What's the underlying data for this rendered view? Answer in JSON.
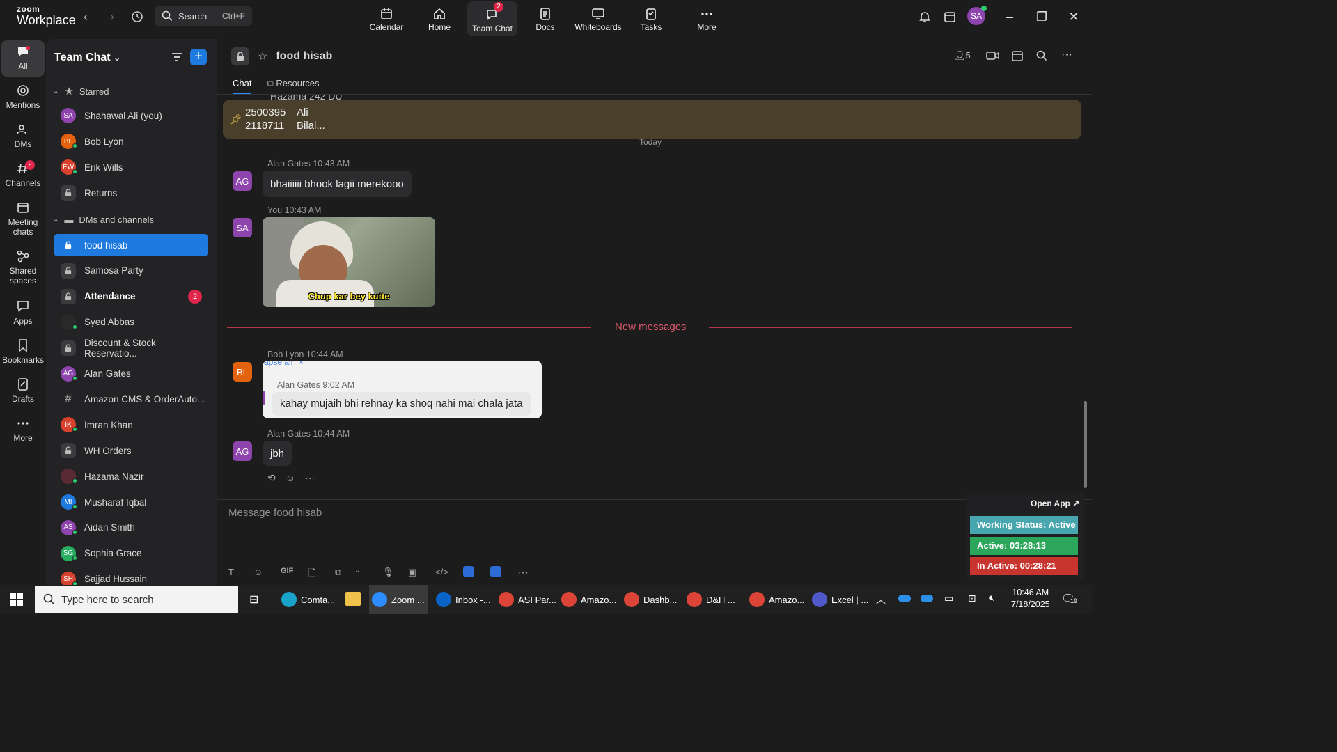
{
  "app": {
    "brand_line1": "zoom",
    "brand_line2": "Workplace"
  },
  "search": {
    "label": "Search",
    "shortcut": "Ctrl+F"
  },
  "top_tabs": [
    {
      "label": "Calendar"
    },
    {
      "label": "Home"
    },
    {
      "label": "Team Chat",
      "badge": "2"
    },
    {
      "label": "Docs"
    },
    {
      "label": "Whiteboards"
    },
    {
      "label": "Tasks"
    },
    {
      "label": "More"
    }
  ],
  "user_avatar": "SA",
  "rail": [
    {
      "label": "All"
    },
    {
      "label": "Mentions"
    },
    {
      "label": "DMs"
    },
    {
      "label": "Channels",
      "badge": "2"
    },
    {
      "label": "Meeting chats"
    },
    {
      "label": "Shared spaces"
    },
    {
      "label": "Apps"
    },
    {
      "label": "Bookmarks"
    },
    {
      "label": "Drafts"
    },
    {
      "label": "More"
    }
  ],
  "sidebar": {
    "title": "Team Chat",
    "starred_label": "Starred",
    "dms_label": "DMs and channels",
    "starred": [
      {
        "initials": "SA",
        "name": "Shahawal Ali (you)",
        "color": "#8e44ad"
      },
      {
        "initials": "BL",
        "name": "Bob Lyon",
        "color": "#e2620e"
      },
      {
        "initials": "EW",
        "name": "Erik Wills",
        "color": "#d9412f"
      },
      {
        "initials": "",
        "name": "Returns",
        "color": "#3b3b3d"
      }
    ],
    "items": [
      {
        "initials": "",
        "name": "food hisab",
        "color": ""
      },
      {
        "initials": "",
        "name": "Samosa Party",
        "color": ""
      },
      {
        "initials": "",
        "name": "Attendance",
        "color": "",
        "count": "2"
      },
      {
        "initials": "",
        "name": "Syed Abbas",
        "color": "#2a2a2a"
      },
      {
        "initials": "",
        "name": "Discount & Stock Reservatio...",
        "color": ""
      },
      {
        "initials": "AG",
        "name": "Alan Gates",
        "color": "#8e44ad"
      },
      {
        "initials": "#",
        "name": "Amazon CMS & OrderAuto...",
        "color": ""
      },
      {
        "initials": "IK",
        "name": "Imran Khan",
        "color": "#d9412f"
      },
      {
        "initials": "",
        "name": "WH Orders",
        "color": ""
      },
      {
        "initials": "",
        "name": "Hazama Nazir",
        "color": "#5a2a33"
      },
      {
        "initials": "MI",
        "name": "Musharaf Iqbal",
        "color": "#1f7ae0"
      },
      {
        "initials": "AS",
        "name": "Aidan Smith",
        "color": "#8e44ad"
      },
      {
        "initials": "SG",
        "name": "Sophia Grace",
        "color": "#27ae60"
      },
      {
        "initials": "SH",
        "name": "Sajjad Hussain",
        "color": "#d9412f"
      }
    ]
  },
  "chat": {
    "title": "food hisab",
    "member_count": "5",
    "tabs": [
      "Chat",
      "Resources"
    ],
    "pinned": {
      "cut_line": "Hazama 242 DU",
      "row1_id": "2500395",
      "row1_name": "Ali",
      "row2_id": "2118711",
      "row2_name": "Bilal..."
    },
    "date_label": "Today",
    "new_messages_label": "New messages",
    "messages": [
      {
        "initials": "AG",
        "sender": "Alan Gates",
        "time": "10:43 AM",
        "text": "bhaiiiiii bhook lagii merekooo"
      },
      {
        "initials": "SA",
        "sender": "You",
        "time": "10:43 AM",
        "image_caption": "Chup kar bey kutte"
      },
      {
        "initials": "BL",
        "sender": "Bob Lyon",
        "time": "10:44 AM",
        "quote_fragment": "apse all",
        "quoted_sender": "Alan Gates",
        "quoted_time": "9:02 AM",
        "quoted_text": "kahay mujaih bhi rehnay ka shoq nahi mai chala jata"
      },
      {
        "initials": "AG",
        "sender": "Alan Gates",
        "time": "10:44 AM",
        "text": "jbh"
      }
    ],
    "composer_placeholder": "Message food hisab",
    "gif_label": "GIF"
  },
  "widget": {
    "open_app": "Open App ↗",
    "working_status": "Working Status: Active",
    "active": "Active: 03:28:13",
    "inactive": "In Active: 00:28:21"
  },
  "taskbar": {
    "search_placeholder": "Type here to search",
    "apps": [
      "Comta...",
      "Zoom ...",
      "Inbox -...",
      "ASI Par...",
      "Amazo...",
      "Dashb...",
      "D&H ...",
      "Amazo...",
      "Excel | ..."
    ],
    "time": "10:46 AM",
    "date": "7/18/2025",
    "notif_count": "19"
  }
}
